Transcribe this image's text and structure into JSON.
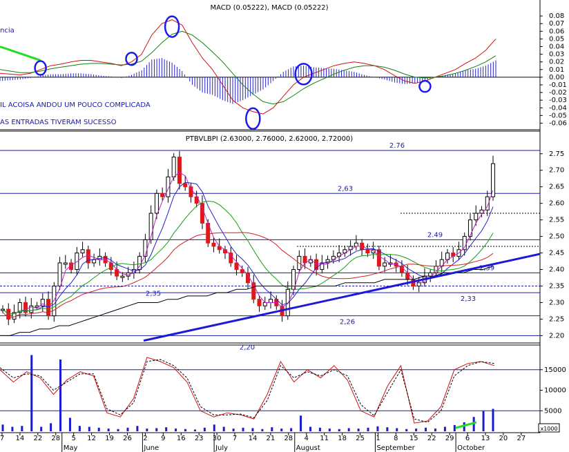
{
  "chart_data": [
    {
      "type": "line",
      "title": "MACD (0.05222), MACD (0.05222)",
      "annotations": [
        "ncia",
        "IL ACOISA ANDOU UM POUCO COMPLICADA",
        "AS ENTRADAS TIVERAM SUCESSO"
      ],
      "ylim": [
        -0.065,
        0.09
      ],
      "yticks": [
        "0.08",
        "0.07",
        "0.06",
        "0.05",
        "0.04",
        "0.03",
        "0.02",
        "0.01",
        "0.00",
        "-0.01",
        "-0.02",
        "-0.03",
        "-0.04",
        "-0.05",
        "-0.06"
      ],
      "series": [
        {
          "values": [
            0.005,
            0.004,
            0.003,
            0.005,
            0.01,
            0.015,
            0.017,
            0.02,
            0.022,
            0.022,
            0.02,
            0.018,
            0.015,
            0.02,
            0.03,
            0.055,
            0.07,
            0.075,
            0.068,
            0.045,
            0.025,
            0.01,
            -0.01,
            -0.03,
            -0.04,
            -0.045,
            -0.048,
            -0.04,
            -0.025,
            -0.01,
            0.0,
            0.005,
            0.01,
            0.015,
            0.018,
            0.02,
            0.018,
            0.015,
            0.01,
            0.002,
            -0.005,
            -0.008,
            -0.005,
            0.0,
            0.005,
            0.01,
            0.018,
            0.025,
            0.035,
            0.05
          ]
        },
        {
          "values": [
            0.01,
            0.008,
            0.006,
            0.006,
            0.008,
            0.011,
            0.013,
            0.015,
            0.017,
            0.018,
            0.018,
            0.017,
            0.016,
            0.017,
            0.021,
            0.032,
            0.045,
            0.056,
            0.06,
            0.055,
            0.045,
            0.033,
            0.02,
            0.005,
            -0.01,
            -0.022,
            -0.032,
            -0.035,
            -0.032,
            -0.024,
            -0.015,
            -0.008,
            -0.002,
            0.004,
            0.009,
            0.013,
            0.015,
            0.015,
            0.013,
            0.009,
            0.004,
            0.0,
            -0.001,
            0.0,
            0.002,
            0.005,
            0.009,
            0.014,
            0.02,
            0.028
          ]
        }
      ]
    },
    {
      "type": "bar",
      "title": "PTBVLBPI (2.63000, 2.76000, 2.62000, 2.72000)",
      "ylim": [
        2.18,
        2.785
      ],
      "yticks": [
        "2.75",
        "2.70",
        "2.65",
        "2.60",
        "2.55",
        "2.50",
        "2.45",
        "2.40",
        "2.35",
        "2.30",
        "2.25",
        "2.20"
      ],
      "levels": [
        {
          "value": 2.76,
          "label": "2.76"
        },
        {
          "value": 2.63,
          "label": "2,63"
        },
        {
          "value": 2.49,
          "label": "2.49"
        },
        {
          "value": 2.39,
          "label": "2,39"
        },
        {
          "value": 2.35,
          "label": "2,35"
        },
        {
          "value": 2.33,
          "label": "2,33"
        },
        {
          "value": 2.26,
          "label": "2,26"
        },
        {
          "value": 2.2,
          "label": "2,20"
        }
      ],
      "close": [
        2.28,
        2.25,
        2.27,
        2.3,
        2.27,
        2.29,
        2.29,
        2.31,
        2.26,
        2.35,
        2.42,
        2.42,
        2.4,
        2.45,
        2.46,
        2.42,
        2.43,
        2.44,
        2.42,
        2.4,
        2.38,
        2.38,
        2.39,
        2.4,
        2.44,
        2.49,
        2.57,
        2.63,
        2.62,
        2.68,
        2.74,
        2.66,
        2.65,
        2.62,
        2.6,
        2.54,
        2.48,
        2.47,
        2.46,
        2.45,
        2.42,
        2.4,
        2.39,
        2.36,
        2.31,
        2.29,
        2.3,
        2.31,
        2.29,
        2.26,
        2.34,
        2.4,
        2.44,
        2.42,
        2.43,
        2.4,
        2.42,
        2.43,
        2.44,
        2.45,
        2.46,
        2.47,
        2.48,
        2.46,
        2.45,
        2.46,
        2.41,
        2.42,
        2.42,
        2.41,
        2.39,
        2.37,
        2.35,
        2.36,
        2.38,
        2.39,
        2.41,
        2.43,
        2.45,
        2.44,
        2.46,
        2.5,
        2.55,
        2.57,
        2.58,
        2.62,
        2.72
      ],
      "ma_close": [
        2.2,
        2.2,
        2.21,
        2.21,
        2.22,
        2.22,
        2.23,
        2.23,
        2.24,
        2.25,
        2.26,
        2.27,
        2.28,
        2.29,
        2.3,
        2.3,
        2.3,
        2.31,
        2.31,
        2.32,
        2.32,
        2.32,
        2.33,
        2.33,
        2.34,
        2.34,
        2.35,
        2.35,
        2.35,
        2.35,
        2.35,
        2.35,
        2.35,
        2.35,
        2.35,
        2.36,
        2.36,
        2.36,
        2.36,
        2.37,
        2.37,
        2.37,
        2.37,
        2.38,
        2.38,
        2.39,
        2.39,
        2.39,
        2.4,
        2.4,
        2.41
      ]
    },
    {
      "type": "line",
      "ylim": [
        0,
        20000
      ],
      "yticks": [
        "15000",
        "10000",
        "5000"
      ],
      "unit": "x1000",
      "x_ticks": [
        "7",
        "14",
        "22",
        "28",
        "5",
        "12",
        "19",
        "26",
        "2",
        "9",
        "16",
        "23",
        "30",
        "7",
        "14",
        "21",
        "28",
        "4",
        "11",
        "18",
        "25",
        "1",
        "8",
        "15",
        "22",
        "29",
        "6",
        "13",
        "20",
        "27"
      ],
      "months": [
        "May",
        "June",
        "July",
        "August",
        "September",
        "October"
      ],
      "series": [
        {
          "values": [
            15000,
            12000,
            14500,
            13000,
            9000,
            12500,
            14500,
            13500,
            4500,
            3500,
            8000,
            18000,
            17000,
            15500,
            12000,
            5000,
            3500,
            4500,
            4000,
            3000,
            9000,
            17000,
            12000,
            15000,
            13000,
            16000,
            12500,
            5000,
            3500,
            11000,
            16000,
            2000,
            2500,
            6000,
            15000,
            16500,
            17000,
            16000
          ]
        },
        {
          "values": [
            15500,
            13000,
            14000,
            13500,
            10000,
            12000,
            14000,
            14000,
            5500,
            4000,
            7000,
            17000,
            17500,
            16000,
            13000,
            6000,
            4000,
            4000,
            4200,
            3300,
            7500,
            16000,
            13000,
            14500,
            13500,
            15000,
            13500,
            6500,
            3800,
            9500,
            15000,
            3000,
            2200,
            5000,
            13500,
            16000,
            17000,
            16500
          ]
        }
      ],
      "volume": [
        1.5,
        1.0,
        1.2,
        17,
        1.0,
        1.8,
        16,
        3.0,
        1.2,
        1.0,
        0.8,
        0.6,
        0.5,
        0.8,
        1.2,
        0.6,
        0.7,
        0.9,
        0.6,
        0.5,
        0.4,
        0.8,
        1.5,
        1.0,
        0.6,
        0.8,
        0.7,
        0.5,
        0.9,
        0.6,
        0.7,
        3.5,
        1.0,
        0.8,
        0.6,
        0.5,
        0.7,
        0.6,
        0.8,
        1.1,
        0.9,
        0.7,
        0.5,
        0.6,
        0.8,
        0.6,
        1.0,
        1.4,
        2.0,
        3.2,
        4.5,
        5.0
      ]
    }
  ]
}
